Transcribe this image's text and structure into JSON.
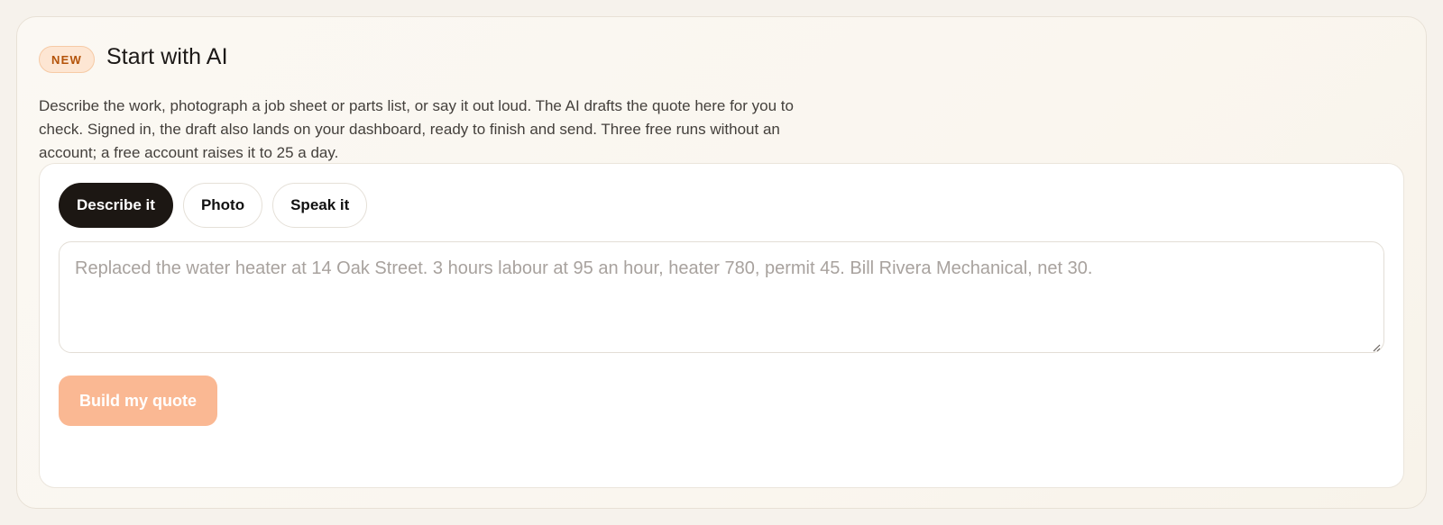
{
  "header": {
    "badge": "NEW",
    "title": "Start with AI",
    "description": "Describe the work, photograph a job sheet or parts list, or say it out loud. The AI drafts the quote here for you to check. Signed in, the draft also lands on your dashboard, ready to finish and send. Three free runs without an account; a free account raises it to 25 a day."
  },
  "tabs": [
    {
      "label": "Describe it",
      "active": true
    },
    {
      "label": "Photo",
      "active": false
    },
    {
      "label": "Speak it",
      "active": false
    }
  ],
  "input": {
    "value": "",
    "placeholder": "Replaced the water heater at 14 Oak Street. 3 hours labour at 95 an hour, heater 780, permit 45. Bill Rivera Mechanical, net 30."
  },
  "actions": {
    "build_label": "Build my quote"
  },
  "colors": {
    "accent": "#fab893",
    "badge_text": "#b45309",
    "badge_bg": "#fde6d3",
    "active_tab": "#1c1713"
  }
}
